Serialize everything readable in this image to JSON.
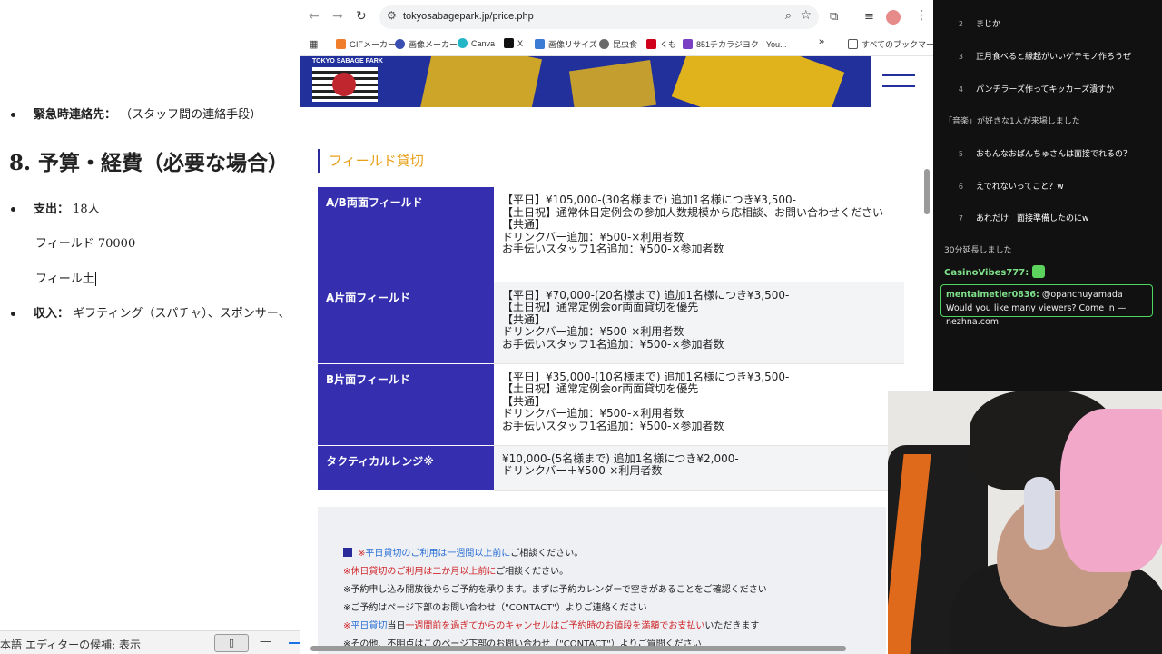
{
  "doc": {
    "emergency_label": "緊急時連絡先：",
    "emergency_value": "（スタッフ間の連絡手段）",
    "heading": "8. 予算・経費（必要な場合）",
    "expense_label": "支出：",
    "expense_value": "18人",
    "field_line": "フィールド 70000",
    "field_partial": "フィール土",
    "income_label": "収入：",
    "income_value": "ギフティング（スパチャ）、スポンサー、",
    "status_lang": "本語",
    "status_editor": "エディターの候補: 表示"
  },
  "browser": {
    "url": "tokyosabagepark.jp/price.php",
    "bookmarks": [
      {
        "label": "GIFメーカー",
        "color": "#f07d2a"
      },
      {
        "label": "画像メーカー",
        "color": "#3a4db0"
      },
      {
        "label": "Canva",
        "color": "#22b6c7"
      },
      {
        "label": "X",
        "color": "#111111"
      },
      {
        "label": "画像リサイズ",
        "color": "#3b7bd6"
      },
      {
        "label": "昆虫食",
        "color": "#6a6a6a"
      },
      {
        "label": "くも",
        "color": "#d0021b"
      },
      {
        "label": "851チカラジヨク - You...",
        "color": "#7b3fc4"
      }
    ],
    "bookmarks_more": "»",
    "all_bookmarks": "すべてのブックマーク"
  },
  "site": {
    "logo_text": "TOKYO SABAGE PARK",
    "section_title": "フィールド貸切",
    "rows": [
      {
        "label": "A/B両面フィールド",
        "desc": "【平日】¥105,000-(30名様まで) 追加1名様につき¥3,500-\n【土日祝】通常休日定例会の参加人数規模から応相談、お問い合わせください\n【共通】\nドリンクバー追加：¥500-×利用者数\nお手伝いスタッフ1名追加：¥500-×参加者数"
      },
      {
        "label": "A片面フィールド",
        "desc": "【平日】¥70,000-(20名様まで) 追加1名様につき¥3,500-\n【土日祝】通常定例会or両面貸切を優先\n【共通】\nドリンクバー追加：¥500-×利用者数\nお手伝いスタッフ1名追加：¥500-×参加者数"
      },
      {
        "label": "B片面フィールド",
        "desc": "【平日】¥35,000-(10名様まで) 追加1名様につき¥3,500-\n【土日祝】通常定例会or両面貸切を優先\n【共通】\nドリンクバー追加：¥500-×利用者数\nお手伝いスタッフ1名追加：¥500-×参加者数"
      },
      {
        "label": "タクティカルレンジ※",
        "desc": "¥10,000-(5名様まで) 追加1名様につき¥2,000-\nドリンクバー＋¥500-×利用者数"
      }
    ],
    "notes": {
      "n1_prefix": "※",
      "n1_blue": "平日貸切のご利用は一週間以上前に",
      "n1_rest": "ご相談ください。",
      "n2_red": "※休日貸切のご利用は二か月以上前に",
      "n2_rest": "ご相談ください。",
      "n3": "※予約申し込み開放後からご予約を承ります。まずは予約カレンダーで空きがあることをご確認ください",
      "n4": "※ご予約はページ下部のお問い合わせ（\"CONTACT\"）よりご連絡ください",
      "n5_prefix": "※",
      "n5_blue": "平日貸切",
      "n5_mid": "当日",
      "n5_red": "一週間前を過ぎてからのキャンセルはご予約時のお値段を満額でお支払い",
      "n5_rest": "いただきます",
      "n6": "※その他、不明点はこのページ下部のお問い合わせ（\"CONTACT\"）よりご質問ください"
    }
  },
  "chat": {
    "items": [
      {
        "num": "2",
        "text": "まじか"
      },
      {
        "num": "3",
        "text": "正月食べると縁起がいいゲテモノ作ろうぜ"
      },
      {
        "num": "4",
        "text": "パンチラーズ作ってキッカーズ潰すか"
      },
      {
        "num": "5",
        "text": "おもんなおばんちゅさんは面接でれるの？"
      },
      {
        "num": "6",
        "text": "えでれないってこと？w"
      },
      {
        "num": "7",
        "text": "あれだけ　面接準備したのにw"
      }
    ],
    "system1": "「音楽」が好きな1人が来場しました",
    "system2": "30分延長しました",
    "user1": "CasinoVibes777:",
    "msg_user": "mentalmetier0836:",
    "msg_text": "@opanchuyamada Would you like many viewers? Come in — nezhna.com"
  }
}
